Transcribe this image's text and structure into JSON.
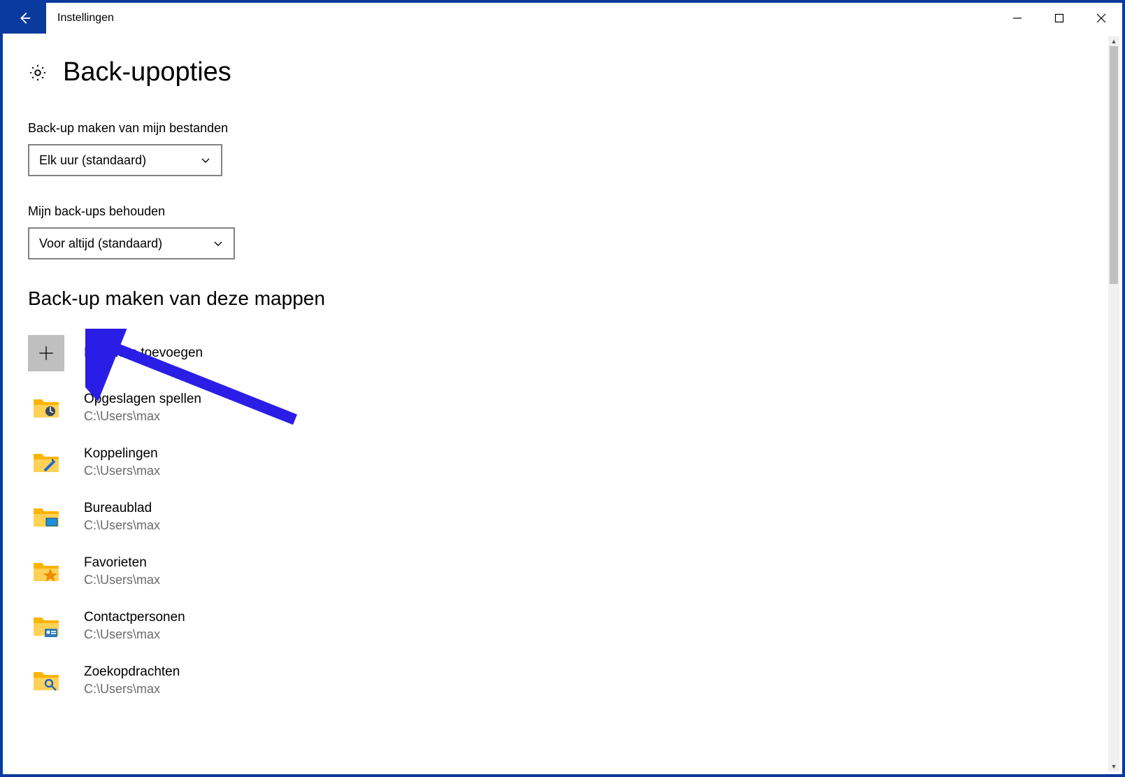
{
  "window": {
    "title": "Instellingen"
  },
  "page": {
    "title": "Back-upopties"
  },
  "backup_frequency": {
    "label": "Back-up maken van mijn bestanden",
    "value": "Elk uur (standaard)"
  },
  "keep_backups": {
    "label": "Mijn back-ups behouden",
    "value": "Voor altijd (standaard)"
  },
  "folders_section": {
    "heading": "Back-up maken van deze mappen",
    "add_label": "Een map toevoegen",
    "items": [
      {
        "name": "Opgeslagen spellen",
        "path": "C:\\Users\\max",
        "icon": "saved-games"
      },
      {
        "name": "Koppelingen",
        "path": "C:\\Users\\max",
        "icon": "links"
      },
      {
        "name": "Bureaublad",
        "path": "C:\\Users\\max",
        "icon": "desktop"
      },
      {
        "name": "Favorieten",
        "path": "C:\\Users\\max",
        "icon": "favorites"
      },
      {
        "name": "Contactpersonen",
        "path": "C:\\Users\\max",
        "icon": "contacts"
      },
      {
        "name": "Zoekopdrachten",
        "path": "C:\\Users\\max",
        "icon": "searches"
      }
    ]
  }
}
